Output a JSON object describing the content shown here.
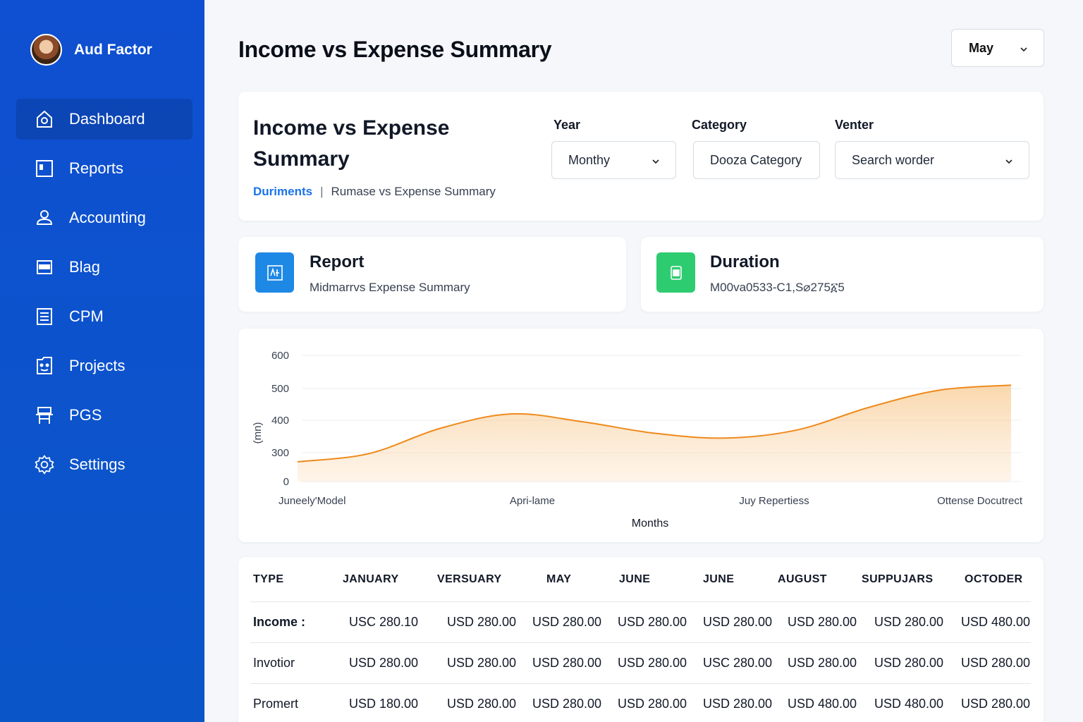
{
  "brand": {
    "name": "Aud Factor"
  },
  "sidebar": {
    "items": [
      {
        "label": "Dashboard",
        "icon": "home-icon",
        "active": true
      },
      {
        "label": "Reports",
        "icon": "report-icon"
      },
      {
        "label": "Accounting",
        "icon": "user-icon"
      },
      {
        "label": "Blag",
        "icon": "card-icon"
      },
      {
        "label": "CPM",
        "icon": "list-icon"
      },
      {
        "label": "Projects",
        "icon": "projects-icon"
      },
      {
        "label": "PGS",
        "icon": "desk-icon"
      },
      {
        "label": "Settings",
        "icon": "gear-icon"
      }
    ]
  },
  "header": {
    "title": "Income vs Expense Summary",
    "month_select": "May"
  },
  "filters": {
    "title": "Income vs Expense Summary",
    "breadcrumb": {
      "link": "Duriments",
      "separator": "|",
      "current": "Rumase vs Expense Summary"
    },
    "year": {
      "label": "Year",
      "value": "Monthy"
    },
    "category": {
      "label": "Category",
      "value": "Dooza Category"
    },
    "venter": {
      "label": "Venter",
      "placeholder": "Search worder"
    }
  },
  "cards": {
    "report": {
      "title": "Report",
      "subtitle": "Midmarrvs Expense Summary",
      "icon": "report-doc-icon",
      "color": "#1e88e5"
    },
    "duration": {
      "title": "Duration",
      "subtitle": "M00va0533-C1,S⌀275፩5",
      "icon": "calendar-doc-icon",
      "color": "#2ecc71"
    }
  },
  "chart_data": {
    "type": "area",
    "title": "",
    "xlabel": "Months",
    "ylabel": "(mn)",
    "x_tick_labels": [
      "Juneely'Model",
      "Apri-lame",
      "Juy Repertiess",
      "Ottense Docutrect"
    ],
    "y_ticks": [
      "0",
      "300",
      "400",
      "500",
      "600"
    ],
    "x": [
      0,
      1,
      2,
      3,
      4,
      5,
      6,
      7,
      8,
      9,
      10
    ],
    "values": [
      205,
      290,
      375,
      420,
      395,
      360,
      345,
      370,
      440,
      495,
      510
    ],
    "color": "#ee8a1c",
    "grid": true
  },
  "table": {
    "headers": [
      "TYPE",
      "JANUARY",
      "VERSUARY",
      "MAY",
      "JUNE",
      "JUNE",
      "AUGUST",
      "SUPPUJARS",
      "OCTODER"
    ],
    "rows": [
      {
        "type": "Income :",
        "bold": true,
        "values": [
          "USC 280.10",
          "USD 280.00",
          "USD 280.00",
          "USD 280.00",
          "USD 280.00",
          "USD 280.00",
          "USD 280.00",
          "USD 480.00"
        ]
      },
      {
        "type": "Invotior",
        "bold": false,
        "values": [
          "USD 280.00",
          "USD 280.00",
          "USD 280.00",
          "USD 280.00",
          "USC 280.00",
          "USD 280.00",
          "USD 280.00",
          "USD 280.00"
        ]
      },
      {
        "type": "Promert",
        "bold": false,
        "values": [
          "USD 180.00",
          "USD 280.00",
          "USD 280.00",
          "USD 280.00",
          "USD 280.00",
          "USD 480.00",
          "USD 480.00",
          "USD 280.00"
        ]
      }
    ]
  }
}
